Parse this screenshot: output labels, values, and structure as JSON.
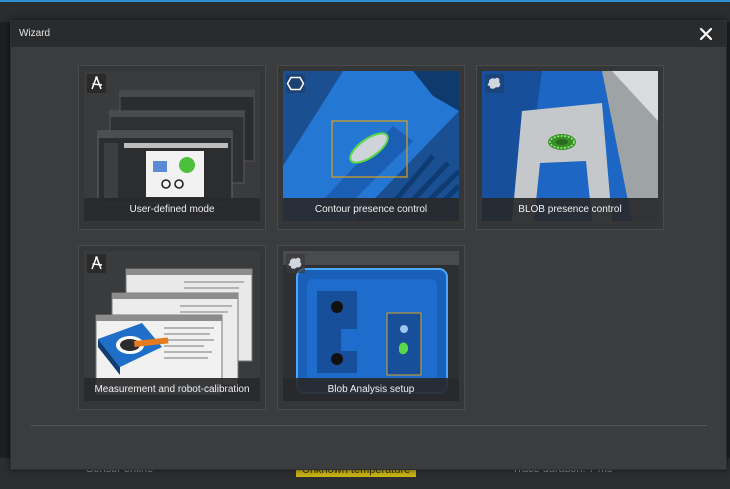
{
  "window": {
    "title": "Wizard"
  },
  "tiles": [
    {
      "label": "User-defined mode",
      "icon": "compass-icon"
    },
    {
      "label": "Contour presence control",
      "icon": "hexagon-icon"
    },
    {
      "label": "BLOB presence control",
      "icon": "blob-icon"
    },
    {
      "label": "Measurement and robot-calibration",
      "icon": "compass-icon"
    },
    {
      "label": "Blob Analysis setup",
      "icon": "blob-icon"
    }
  ],
  "background_status": {
    "left_text": "Sensor online",
    "warning_text": "Unknown temperature",
    "right_text": "Trace duration: 7 ms"
  },
  "colors": {
    "accent": "#2e8fd3",
    "blue_part": "#1f6fc9",
    "highlight_green": "#5ad84a",
    "warning": "#c8b414"
  }
}
